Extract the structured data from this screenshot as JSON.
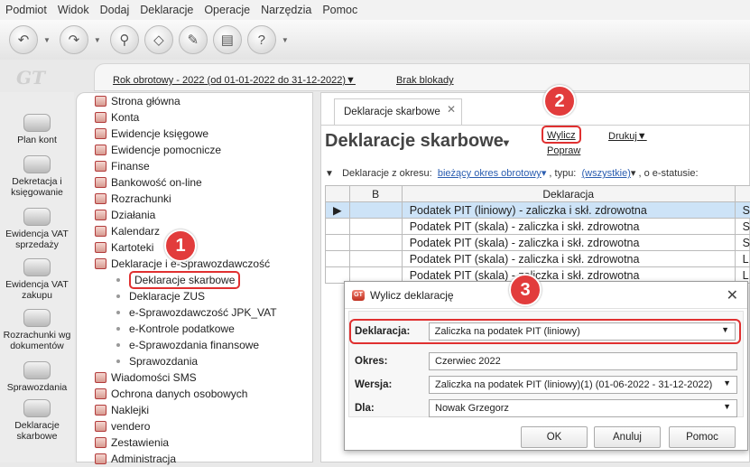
{
  "menu": [
    "Podmiot",
    "Widok",
    "Dodaj",
    "Deklaracje",
    "Operacje",
    "Narzędzia",
    "Pomoc"
  ],
  "logo_text": "GT",
  "header": {
    "year": "Rok obrotowy - 2022  (od 01-01-2022 do 31-12-2022)▼",
    "lock": "Brak blokady"
  },
  "leftnav": [
    "Plan kont",
    "Dekretacja i księgowanie",
    "Ewidencja VAT sprzedaży",
    "Ewidencja VAT zakupu",
    "Rozrachunki wg dokumentów",
    "Sprawozdania",
    "Deklaracje skarbowe"
  ],
  "tree": {
    "items": [
      "Strona główna",
      "Konta",
      "Ewidencje księgowe",
      "Ewidencje pomocnicze",
      "Finanse",
      "Bankowość on-line",
      "Rozrachunki",
      "Działania",
      "Kalendarz",
      "Kartoteki",
      "Deklaracje i e-Sprawozdawczość"
    ],
    "sub": [
      "Deklaracje skarbowe",
      "Deklaracje ZUS",
      "e-Sprawozdawczość JPK_VAT",
      "e-Kontrole podatkowe",
      "e-Sprawozdania finansowe",
      "Sprawozdania"
    ],
    "items2": [
      "Wiadomości SMS",
      "Ochrona danych osobowych",
      "Naklejki",
      "vendero",
      "Zestawienia",
      "Administracja"
    ]
  },
  "badges": {
    "b1": "1",
    "b2": "2",
    "b3": "3"
  },
  "main": {
    "tab": "Deklaracje skarbowe",
    "title": "Deklaracje skarbowe",
    "wylicz": "Wylicz",
    "popraw": "Popraw",
    "drukuj": "Drukuj",
    "filter_label": "Deklaracje z okresu:",
    "filter_period": "bieżący okres obrotowy",
    "type_label": ", typu:",
    "type_value": "(wszystkie)",
    "status_label": ", o e-statusie:"
  },
  "grid": {
    "headers": [
      "B",
      "Deklaracja"
    ],
    "rows": [
      {
        "decl": "Podatek PIT (liniowy) - zaliczka i skł. zdrowotna",
        "last": "S"
      },
      {
        "decl": "Podatek PIT (skala) - zaliczka i skł. zdrowotna",
        "last": "S"
      },
      {
        "decl": "Podatek PIT (skala) - zaliczka i skł. zdrowotna",
        "last": "S"
      },
      {
        "decl": "Podatek PIT (skala) - zaliczka i skł. zdrowotna",
        "last": "L"
      },
      {
        "decl": "Podatek PIT (skala) - zaliczka i skł. zdrowotna",
        "last": "L"
      }
    ]
  },
  "dialog": {
    "title": "Wylicz deklarację",
    "fields": [
      {
        "label": "Deklaracja:",
        "value": "Zaliczka na podatek PIT (liniowy)"
      },
      {
        "label": "Okres:",
        "value": "Czerwiec 2022"
      },
      {
        "label": "Wersja:",
        "value": "Zaliczka na podatek PIT (liniowy)(1) (01-06-2022 - 31-12-2022)"
      },
      {
        "label": "Dla:",
        "value": "Nowak Grzegorz"
      }
    ],
    "ok": "OK",
    "cancel": "Anuluj",
    "help": "Pomoc"
  },
  "colors": {
    "accent": "#e03030",
    "selection": "#cde3f7",
    "link": "#2a5db0"
  }
}
